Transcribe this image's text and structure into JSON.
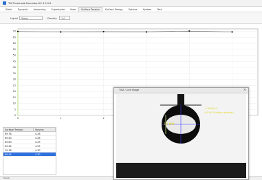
{
  "window": {
    "title": "Tilt-Threshold-Simulator-KV 4.0.0.6"
  },
  "menu": {
    "tabs": [
      "Static",
      "Dynamic",
      "Advancing",
      "Superhydro",
      "View",
      "Surface Tension",
      "Surface Energy",
      "Options",
      "System",
      "Test"
    ],
    "active_index": 5
  },
  "toolbar": {
    "liquid_label": "Liquid",
    "liquid_value": "Water",
    "density_label": "Density",
    "density_value": "1.0"
  },
  "chart_data": {
    "type": "line",
    "y_ticks": [
      "0",
      "5",
      "10",
      "15",
      "20",
      "25",
      "30",
      "35",
      "40",
      "45",
      "50",
      "55",
      "60",
      "65",
      "70"
    ],
    "x_ticks": [
      "0",
      "1",
      "2",
      "3",
      "4",
      "5"
    ],
    "xlim": [
      0,
      5.6
    ],
    "ylim": [
      0,
      72
    ],
    "x": [
      0,
      1,
      2,
      3,
      4,
      5
    ],
    "values": [
      69.78,
      69.43,
      69.63,
      69.44,
      70.18,
      69.43
    ],
    "grid": true
  },
  "table": {
    "headers": [
      "Surface Tension",
      "Volume"
    ],
    "rows": [
      [
        "69.78",
        "4.28"
      ],
      [
        "69.43",
        "4.28"
      ],
      [
        "69.63",
        "4.29"
      ],
      [
        "69.44",
        "4.29"
      ],
      [
        "70.18",
        "4.30"
      ],
      [
        "69.43",
        "4.30"
      ]
    ],
    "selected_index": 5
  },
  "dialog": {
    "title": "Tilt2 / Live Image",
    "close_glyph": "×",
    "overlay_line1": "4.3000 µl",
    "overlay_line2": "67.90 Surface tension",
    "overlay_left": "3.0 N/M"
  },
  "status": {
    "text": "Ready"
  },
  "colors": {
    "accent": "#2f6fde",
    "overlay_text": "#e4d51a",
    "axis_left": "#b8e07a",
    "drop": "#0c0c0c",
    "crosshair": "#3b3bff"
  }
}
